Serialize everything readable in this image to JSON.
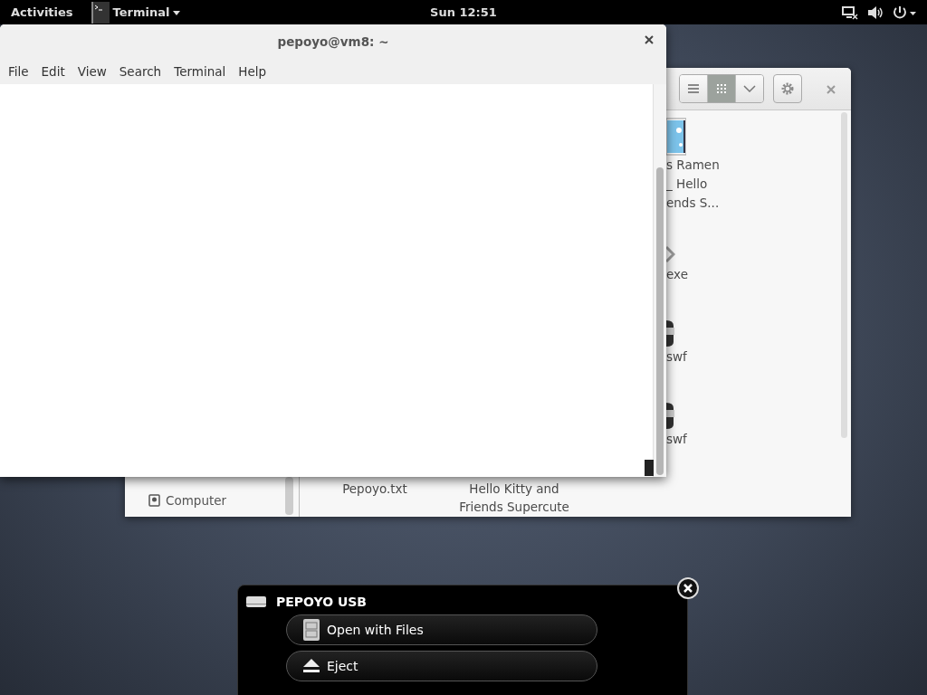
{
  "top_bar": {
    "activities": "Activities",
    "app_menu": "Terminal",
    "clock": "Sun 12:51"
  },
  "files_window": {
    "view_buttons": [
      {
        "kind": "list",
        "selected": false
      },
      {
        "kind": "grid",
        "selected": true
      }
    ],
    "sidebar_items": [
      "Computer"
    ],
    "side_column": [
      {
        "kind": "video",
        "lines": [
          "s Ramen",
          "_ Hello",
          "ends S..."
        ]
      },
      {
        "kind": "exe",
        "lines": [
          "exe"
        ]
      },
      {
        "kind": "flash",
        "lines": [
          "swf"
        ]
      },
      {
        "kind": "flash",
        "lines": [
          "swf"
        ]
      }
    ],
    "bottom_row": [
      {
        "lines": [
          "Pepoyo.txt"
        ]
      },
      {
        "lines": [
          "Hello Kitty and",
          "Friends Supercute"
        ]
      }
    ]
  },
  "terminal_window": {
    "title": "pepoyo@vm8: ~",
    "menus": [
      "File",
      "Edit",
      "View",
      "Search",
      "Terminal",
      "Help"
    ]
  },
  "notification": {
    "title": "PEPOYO USB",
    "actions": [
      {
        "kind": "files",
        "label": "Open with Files"
      },
      {
        "kind": "eject",
        "label": "Eject"
      }
    ]
  }
}
